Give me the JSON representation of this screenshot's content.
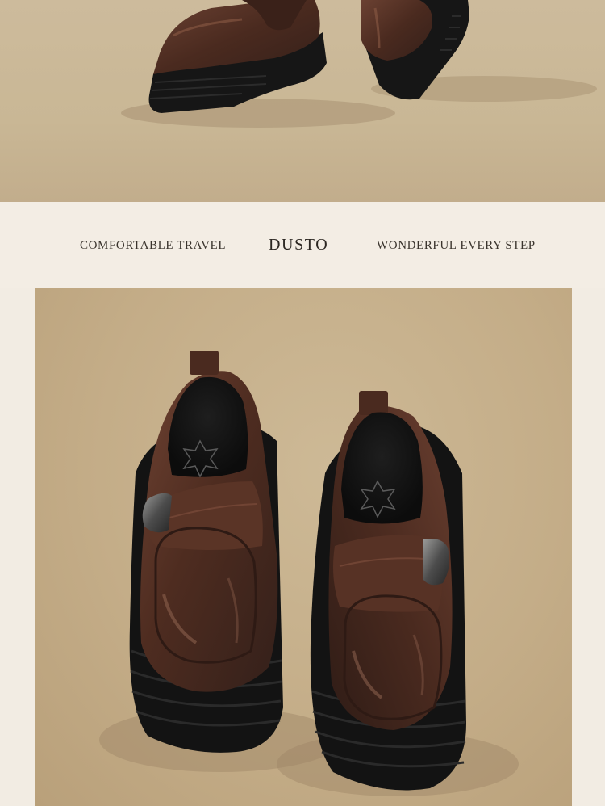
{
  "tagline": {
    "left": "COMFORTABLE TRAVEL",
    "brand": "DUSTO",
    "right": "WONDERFUL EVERY STEP"
  },
  "colors": {
    "page_background": "#f2ece3",
    "backdrop": "#c7b390",
    "leather": "#4a2a1f",
    "sole": "#141414",
    "text": "#3a342d"
  }
}
